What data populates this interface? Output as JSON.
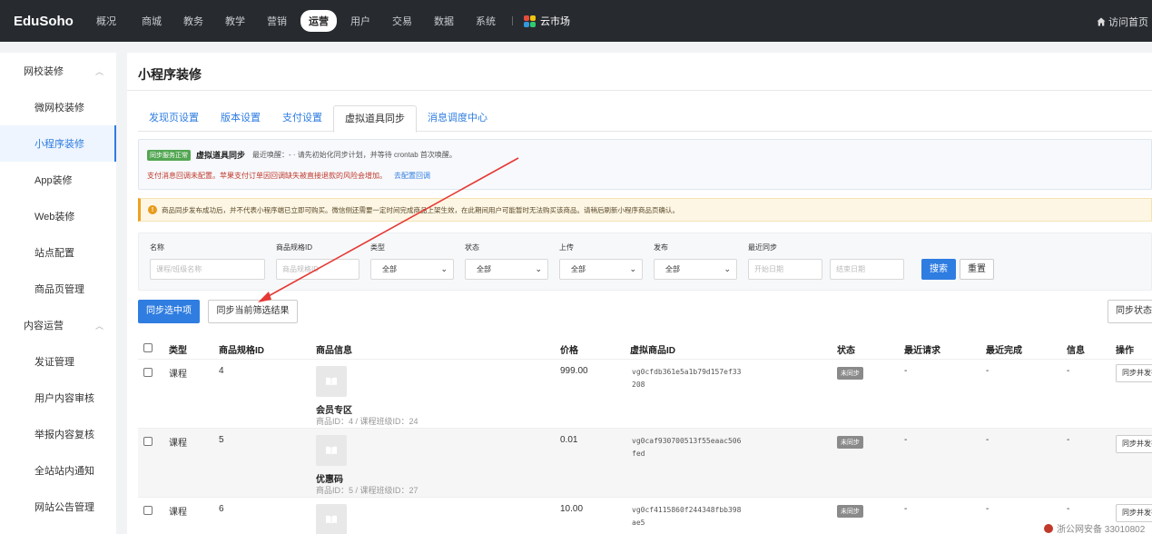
{
  "topbar": {
    "logo": "EduSoho",
    "nav": [
      "概况",
      "商城",
      "教务",
      "教学",
      "营销",
      "运营",
      "用户",
      "交易",
      "数据",
      "系统"
    ],
    "active_nav": "运营",
    "cloud_market": "云市场",
    "home_link": "访问首页",
    "colors": {
      "bg": "#272b30",
      "cloud": [
        "#e74c3c",
        "#f1c40f",
        "#3498db",
        "#2ecc71"
      ]
    }
  },
  "sidebar": {
    "group1": "网校装修",
    "group1_items": [
      "微网校装修",
      "小程序装修",
      "App装修",
      "Web装修",
      "站点配置",
      "商品页管理"
    ],
    "active_item": "小程序装修",
    "group2": "内容运营",
    "group2_items": [
      "发证管理",
      "用户内容审核",
      "举报内容复核",
      "全站站内通知",
      "网站公告管理"
    ]
  },
  "page": {
    "title": "小程序装修",
    "tabs": [
      "发现页设置",
      "版本设置",
      "支付设置",
      "虚拟道具同步",
      "消息调度中心"
    ],
    "active_tab": "虚拟道具同步"
  },
  "sync_info": {
    "status_tag": "同步服务正常",
    "name": "虚拟道具同步",
    "desc": "最近唤醒：- · 请先初始化同步计划，并等待 crontab 首次唤醒。",
    "warn": "支付消息回调未配置。苹果支付订单因回调缺失被直接退款的风险会增加。",
    "link": "去配置回调"
  },
  "notice": "商品同步发布成功后，并不代表小程序端已立即可购买。微信侧还需要一定时间完成商品上架生效，在此期间用户可能暂时无法购买该商品。请稍后刷新小程序商品页确认。",
  "filters": {
    "name_label": "名称",
    "name_placeholder": "课程/班级名称",
    "spec_label": "商品规格ID",
    "spec_placeholder": "商品规格ID",
    "type_label": "类型",
    "type_value": "全部",
    "status_label": "状态",
    "status_value": "全部",
    "upload_label": "上传",
    "upload_value": "全部",
    "publish_label": "发布",
    "publish_value": "全部",
    "last_sync_label": "最近同步",
    "start_placeholder": "开始日期",
    "end_placeholder": "结束日期",
    "search_button": "搜索",
    "reset_button": "重置"
  },
  "actions": {
    "sync_selected": "同步选中项",
    "sync_filtered": "同步当前筛选结果",
    "sync_status": "同步状态"
  },
  "table": {
    "headers": [
      "类型",
      "商品规格ID",
      "商品信息",
      "价格",
      "虚拟商品ID",
      "状态",
      "最近请求",
      "最近完成",
      "信息",
      "操作"
    ],
    "rows": [
      {
        "type": "课程",
        "spec_id": "4",
        "name": "会员专区",
        "sub": "商品ID：4 / 课程班级ID：24",
        "price": "999.00",
        "vid": "vg0cfdb361e5a1b79d157ef33208",
        "status": "未同步",
        "last_req": "-",
        "last_done": "-",
        "info": "-",
        "op": "同步并发布"
      },
      {
        "type": "课程",
        "spec_id": "5",
        "name": "优惠码",
        "sub": "商品ID：5 / 课程班级ID：27",
        "price": "0.01",
        "vid": "vg0caf930700513f55eaac506fed",
        "status": "未同步",
        "last_req": "-",
        "last_done": "-",
        "info": "-",
        "op": "同步并发布"
      },
      {
        "type": "课程",
        "spec_id": "6",
        "name": "",
        "sub": "",
        "price": "10.00",
        "vid": "vg0cf4115860f244348fbb398ae5",
        "status": "未同步",
        "last_req": "-",
        "last_done": "-",
        "info": "-",
        "op": "同步并发布"
      }
    ]
  },
  "footer": {
    "beian": "浙公网安备 33010802"
  },
  "annotation": {
    "arrow_color": "#e53935"
  }
}
